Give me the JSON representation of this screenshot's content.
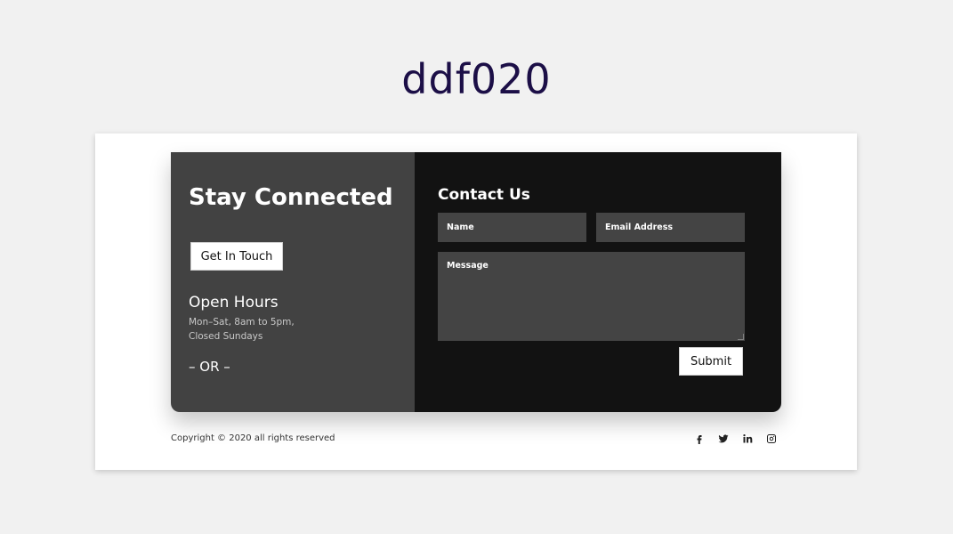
{
  "page": {
    "title": "ddf020"
  },
  "left_panel": {
    "title": "Stay Connected",
    "button_label": "Get In Touch",
    "hours_title": "Open Hours",
    "hours_line1": "Mon–Sat, 8am to 5pm,",
    "hours_line2": "Closed Sundays",
    "or_text": "– OR –"
  },
  "contact_form": {
    "title": "Contact Us",
    "name_placeholder": "Name",
    "email_placeholder": "Email Address",
    "message_placeholder": "Message",
    "submit_label": "Submit"
  },
  "footer": {
    "copyright": "Copyright © 2020 all rights reserved",
    "social_icons": [
      "facebook-icon",
      "twitter-icon",
      "linkedin-icon",
      "instagram-icon"
    ]
  },
  "colors": {
    "title_color": "#1c0f47",
    "left_panel_bg": "#424242",
    "right_panel_bg": "#121212",
    "field_bg": "#444444",
    "page_bg": "#f1f1f1"
  }
}
